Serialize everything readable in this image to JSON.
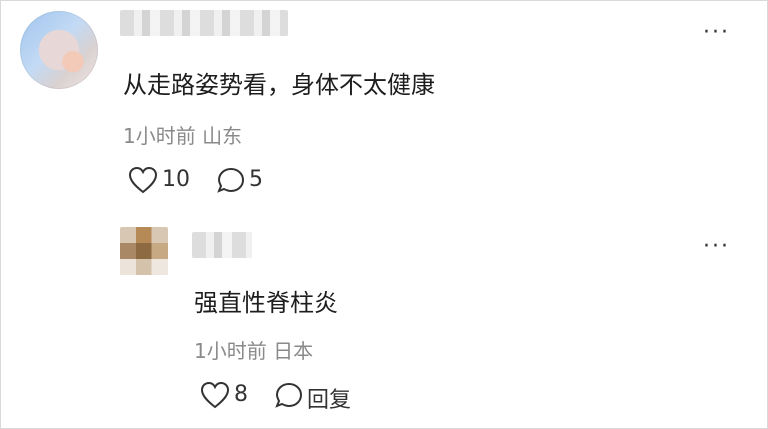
{
  "comment": {
    "text": "从走路姿势看，身体不太健康",
    "time_location": "1小时前 山东",
    "like_count": "10",
    "comment_count": "5",
    "more_label": "···"
  },
  "reply": {
    "text": "强直性脊柱炎",
    "time_location": "1小时前 日本",
    "like_count": "8",
    "reply_label": "回复",
    "more_label": "···"
  }
}
